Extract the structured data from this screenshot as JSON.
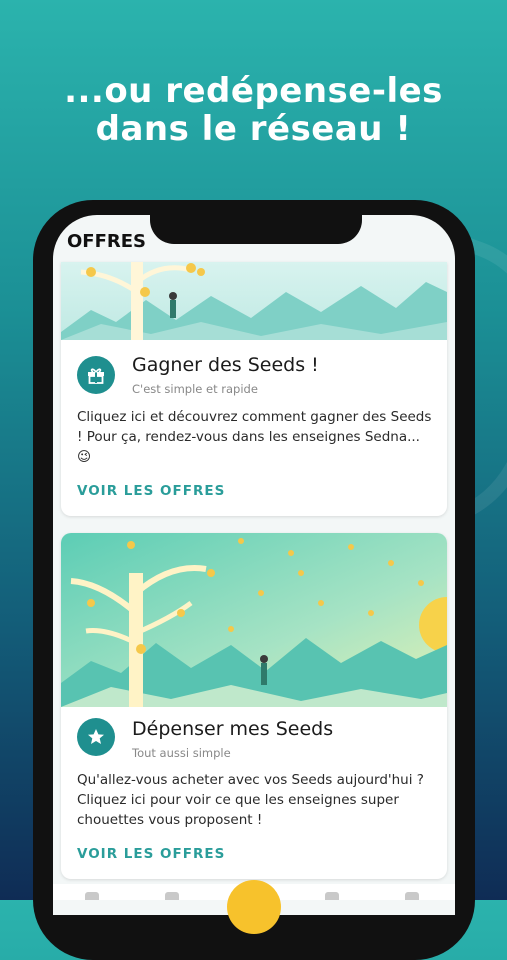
{
  "headline": {
    "line1": "...ou redépense-les",
    "line2": "dans le réseau !"
  },
  "app": {
    "title": "OFFRES"
  },
  "cards": [
    {
      "title": "Gagner des Seeds !",
      "subtitle": "C'est simple et rapide",
      "body": "Cliquez ici et découvrez comment gagner des Seeds ! Pour ça, rendez-vous dans les enseignes Sedna... 😉",
      "link": "VOIR LES OFFRES",
      "icon": "gift-icon"
    },
    {
      "title": "Dépenser mes Seeds",
      "subtitle": "Tout aussi simple",
      "body": "Qu'allez-vous acheter avec vos Seeds aujourd'hui ? Cliquez ici pour voir ce que les enseignes super chouettes vous proposent !",
      "link": "VOIR LES OFFRES",
      "icon": "star-icon"
    }
  ],
  "colors": {
    "accent": "#2a9d9a",
    "icon_bg": "#1f8f8f",
    "fab": "#f7c22c"
  }
}
